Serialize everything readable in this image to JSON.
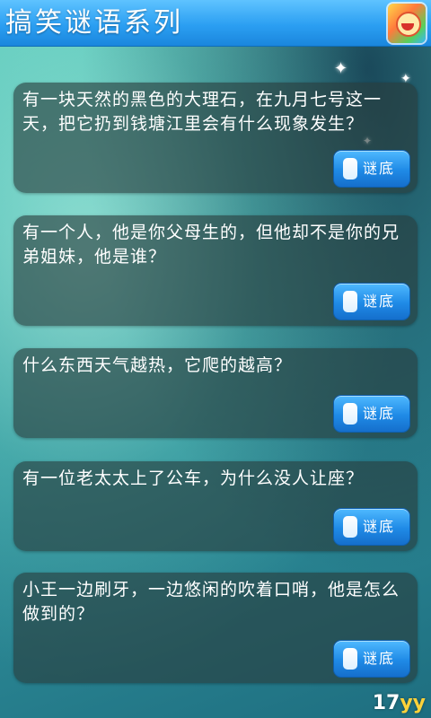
{
  "header": {
    "title": "搞笑谜语系列",
    "app_icon": "app-logo-icon"
  },
  "riddles": [
    {
      "text": "有一块天然的黑色的大理石，在九月七号这一天，把它扔到钱塘江里会有什么现象发生？",
      "button_label": "谜底"
    },
    {
      "text": "有一个人，他是你父母生的，但他却不是你的兄弟姐妹，他是谁？",
      "button_label": "谜底"
    },
    {
      "text": "什么东西天气越热，它爬的越高？",
      "button_label": "谜底"
    },
    {
      "text": "有一位老太太上了公车，为什么没人让座？",
      "button_label": "谜底"
    },
    {
      "text": "小王一边刷牙，一边悠闲的吹着口哨，他是怎么做到的？",
      "button_label": "谜底"
    }
  ],
  "watermark": {
    "part1": "17",
    "part2": "yy"
  },
  "colors": {
    "header": "#2b9ff2",
    "button": "#1f8ae6",
    "card": "#2c3f40"
  }
}
